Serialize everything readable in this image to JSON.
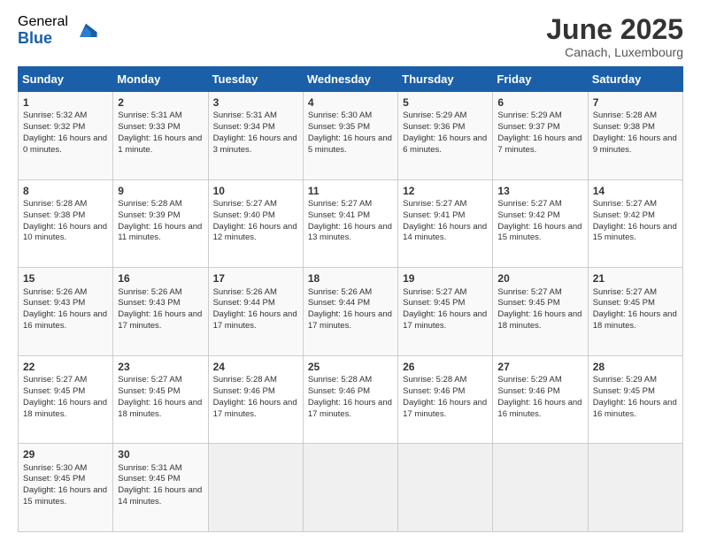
{
  "header": {
    "logo_general": "General",
    "logo_blue": "Blue",
    "title": "June 2025",
    "location": "Canach, Luxembourg"
  },
  "days_of_week": [
    "Sunday",
    "Monday",
    "Tuesday",
    "Wednesday",
    "Thursday",
    "Friday",
    "Saturday"
  ],
  "weeks": [
    [
      {
        "day": "1",
        "sunrise": "Sunrise: 5:32 AM",
        "sunset": "Sunset: 9:32 PM",
        "daylight": "Daylight: 16 hours and 0 minutes."
      },
      {
        "day": "2",
        "sunrise": "Sunrise: 5:31 AM",
        "sunset": "Sunset: 9:33 PM",
        "daylight": "Daylight: 16 hours and 1 minute."
      },
      {
        "day": "3",
        "sunrise": "Sunrise: 5:31 AM",
        "sunset": "Sunset: 9:34 PM",
        "daylight": "Daylight: 16 hours and 3 minutes."
      },
      {
        "day": "4",
        "sunrise": "Sunrise: 5:30 AM",
        "sunset": "Sunset: 9:35 PM",
        "daylight": "Daylight: 16 hours and 5 minutes."
      },
      {
        "day": "5",
        "sunrise": "Sunrise: 5:29 AM",
        "sunset": "Sunset: 9:36 PM",
        "daylight": "Daylight: 16 hours and 6 minutes."
      },
      {
        "day": "6",
        "sunrise": "Sunrise: 5:29 AM",
        "sunset": "Sunset: 9:37 PM",
        "daylight": "Daylight: 16 hours and 7 minutes."
      },
      {
        "day": "7",
        "sunrise": "Sunrise: 5:28 AM",
        "sunset": "Sunset: 9:38 PM",
        "daylight": "Daylight: 16 hours and 9 minutes."
      }
    ],
    [
      {
        "day": "8",
        "sunrise": "Sunrise: 5:28 AM",
        "sunset": "Sunset: 9:38 PM",
        "daylight": "Daylight: 16 hours and 10 minutes."
      },
      {
        "day": "9",
        "sunrise": "Sunrise: 5:28 AM",
        "sunset": "Sunset: 9:39 PM",
        "daylight": "Daylight: 16 hours and 11 minutes."
      },
      {
        "day": "10",
        "sunrise": "Sunrise: 5:27 AM",
        "sunset": "Sunset: 9:40 PM",
        "daylight": "Daylight: 16 hours and 12 minutes."
      },
      {
        "day": "11",
        "sunrise": "Sunrise: 5:27 AM",
        "sunset": "Sunset: 9:41 PM",
        "daylight": "Daylight: 16 hours and 13 minutes."
      },
      {
        "day": "12",
        "sunrise": "Sunrise: 5:27 AM",
        "sunset": "Sunset: 9:41 PM",
        "daylight": "Daylight: 16 hours and 14 minutes."
      },
      {
        "day": "13",
        "sunrise": "Sunrise: 5:27 AM",
        "sunset": "Sunset: 9:42 PM",
        "daylight": "Daylight: 16 hours and 15 minutes."
      },
      {
        "day": "14",
        "sunrise": "Sunrise: 5:27 AM",
        "sunset": "Sunset: 9:42 PM",
        "daylight": "Daylight: 16 hours and 15 minutes."
      }
    ],
    [
      {
        "day": "15",
        "sunrise": "Sunrise: 5:26 AM",
        "sunset": "Sunset: 9:43 PM",
        "daylight": "Daylight: 16 hours and 16 minutes."
      },
      {
        "day": "16",
        "sunrise": "Sunrise: 5:26 AM",
        "sunset": "Sunset: 9:43 PM",
        "daylight": "Daylight: 16 hours and 17 minutes."
      },
      {
        "day": "17",
        "sunrise": "Sunrise: 5:26 AM",
        "sunset": "Sunset: 9:44 PM",
        "daylight": "Daylight: 16 hours and 17 minutes."
      },
      {
        "day": "18",
        "sunrise": "Sunrise: 5:26 AM",
        "sunset": "Sunset: 9:44 PM",
        "daylight": "Daylight: 16 hours and 17 minutes."
      },
      {
        "day": "19",
        "sunrise": "Sunrise: 5:27 AM",
        "sunset": "Sunset: 9:45 PM",
        "daylight": "Daylight: 16 hours and 17 minutes."
      },
      {
        "day": "20",
        "sunrise": "Sunrise: 5:27 AM",
        "sunset": "Sunset: 9:45 PM",
        "daylight": "Daylight: 16 hours and 18 minutes."
      },
      {
        "day": "21",
        "sunrise": "Sunrise: 5:27 AM",
        "sunset": "Sunset: 9:45 PM",
        "daylight": "Daylight: 16 hours and 18 minutes."
      }
    ],
    [
      {
        "day": "22",
        "sunrise": "Sunrise: 5:27 AM",
        "sunset": "Sunset: 9:45 PM",
        "daylight": "Daylight: 16 hours and 18 minutes."
      },
      {
        "day": "23",
        "sunrise": "Sunrise: 5:27 AM",
        "sunset": "Sunset: 9:45 PM",
        "daylight": "Daylight: 16 hours and 18 minutes."
      },
      {
        "day": "24",
        "sunrise": "Sunrise: 5:28 AM",
        "sunset": "Sunset: 9:46 PM",
        "daylight": "Daylight: 16 hours and 17 minutes."
      },
      {
        "day": "25",
        "sunrise": "Sunrise: 5:28 AM",
        "sunset": "Sunset: 9:46 PM",
        "daylight": "Daylight: 16 hours and 17 minutes."
      },
      {
        "day": "26",
        "sunrise": "Sunrise: 5:28 AM",
        "sunset": "Sunset: 9:46 PM",
        "daylight": "Daylight: 16 hours and 17 minutes."
      },
      {
        "day": "27",
        "sunrise": "Sunrise: 5:29 AM",
        "sunset": "Sunset: 9:46 PM",
        "daylight": "Daylight: 16 hours and 16 minutes."
      },
      {
        "day": "28",
        "sunrise": "Sunrise: 5:29 AM",
        "sunset": "Sunset: 9:45 PM",
        "daylight": "Daylight: 16 hours and 16 minutes."
      }
    ],
    [
      {
        "day": "29",
        "sunrise": "Sunrise: 5:30 AM",
        "sunset": "Sunset: 9:45 PM",
        "daylight": "Daylight: 16 hours and 15 minutes."
      },
      {
        "day": "30",
        "sunrise": "Sunrise: 5:31 AM",
        "sunset": "Sunset: 9:45 PM",
        "daylight": "Daylight: 16 hours and 14 minutes."
      },
      {
        "day": "",
        "sunrise": "",
        "sunset": "",
        "daylight": ""
      },
      {
        "day": "",
        "sunrise": "",
        "sunset": "",
        "daylight": ""
      },
      {
        "day": "",
        "sunrise": "",
        "sunset": "",
        "daylight": ""
      },
      {
        "day": "",
        "sunrise": "",
        "sunset": "",
        "daylight": ""
      },
      {
        "day": "",
        "sunrise": "",
        "sunset": "",
        "daylight": ""
      }
    ]
  ]
}
